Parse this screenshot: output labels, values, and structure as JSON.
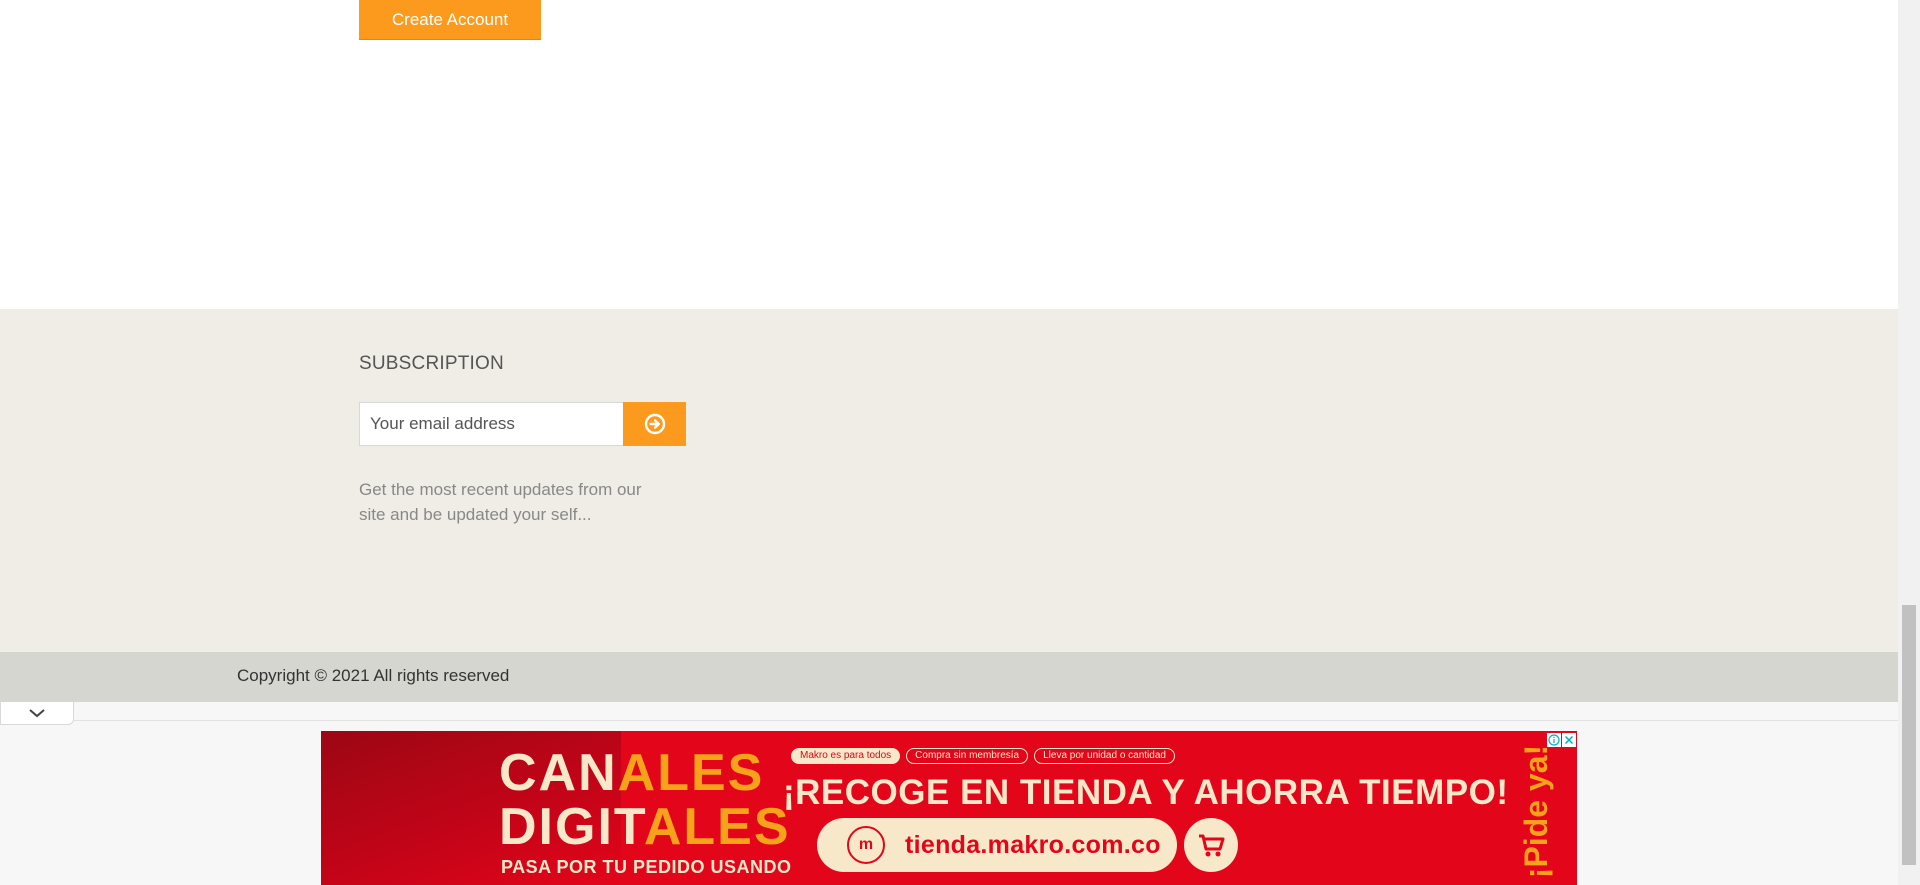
{
  "account": {
    "create_label": "Create Account"
  },
  "subscription": {
    "title": "SUBSCRIPTION",
    "email_placeholder": "Your email address",
    "submit_icon": "arrow-circle-right-icon",
    "description": "Get the most recent updates from our site and be updated your self..."
  },
  "footer": {
    "copyright": "Copyright © 2021 All rights reserved"
  },
  "ad": {
    "toggle_icon": "chevron-down-icon",
    "canales": {
      "part1": "CAN",
      "part2": "ALES"
    },
    "digitales": {
      "part1": "DIGIT",
      "part2": "ALES"
    },
    "tagline": "PASA POR TU PEDIDO USANDO",
    "pills": [
      "Makro es para todos",
      "Compra sin membresía",
      "Lleva por unidad o cantidad"
    ],
    "headline": "¡RECOGE EN TIENDA Y AHORRA TIEMPO!",
    "logo_letter": "m",
    "url": "tienda.makro.com.co",
    "side_text": "¡Pide ya!",
    "info_icon": "info-icon",
    "close_icon": "close-icon"
  },
  "colors": {
    "accent": "#fb9a1c",
    "subscription_bg": "#efede6",
    "copyright_bg": "#d6d6d0",
    "ad_red": "#e3051a",
    "ad_cream": "#f6e8c8",
    "ad_orange": "#f7a21b"
  }
}
